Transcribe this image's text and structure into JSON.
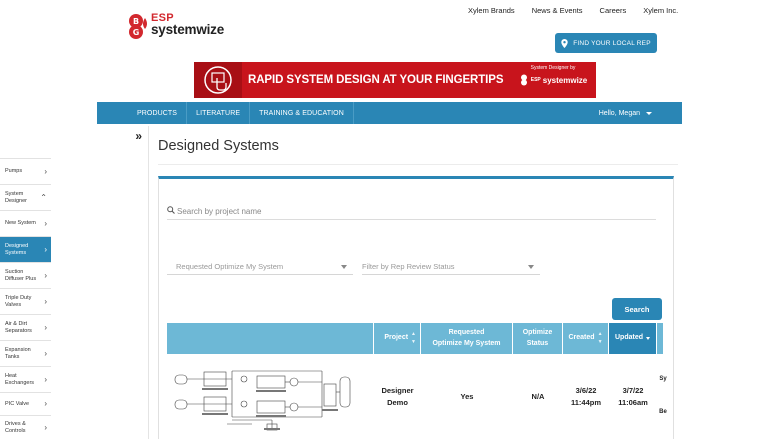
{
  "top_links": [
    "Xylem Brands",
    "News & Events",
    "Careers",
    "Xylem Inc."
  ],
  "logo": {
    "esp": "ESP",
    "systemwize": "systemwize"
  },
  "find_rep": "FIND YOUR LOCAL REP",
  "banner": {
    "headline": "RAPID SYSTEM DESIGN AT YOUR FINGERTIPS",
    "small": "System Designer by",
    "mini_esp": "ESP",
    "mini_sys": "systemwize"
  },
  "nav": {
    "items": [
      "PRODUCTS",
      "LITERATURE",
      "TRAINING & EDUCATION"
    ],
    "user": "Hello, Megan"
  },
  "sidebar": {
    "collapse": "»",
    "items": [
      {
        "label": "Pumps",
        "chevron": "›"
      },
      {
        "label": "System Designer",
        "chevron": "⌃"
      },
      {
        "label": "New System",
        "chevron": "›"
      },
      {
        "label": "Designed Systems",
        "chevron": "›"
      },
      {
        "label": "Suction Diffuser Plus",
        "chevron": "›"
      },
      {
        "label": "Triple Duty Valves",
        "chevron": "›"
      },
      {
        "label": "Air & Dirt Separators",
        "chevron": "›"
      },
      {
        "label": "Expansion Tanks",
        "chevron": "›"
      },
      {
        "label": "Heat Exchangers",
        "chevron": "›"
      },
      {
        "label": "PIC Valve",
        "chevron": "›"
      },
      {
        "label": "Drives & Controls",
        "chevron": "›"
      }
    ]
  },
  "page_title": "Designed Systems",
  "search": {
    "placeholder": "Search by project name"
  },
  "filters": {
    "optimize": "Requested Optimize My System",
    "rep_status": "Filter by Rep Review Status"
  },
  "search_button": "Search",
  "table": {
    "headers": {
      "project": "Project",
      "optimize_line1": "Requested",
      "optimize_line2": "Optimize My System",
      "status_line1": "Optimize",
      "status_line2": "Status",
      "created": "Created",
      "updated": "Updated"
    },
    "row": {
      "project_line1": "Designer",
      "project_line2": "Demo",
      "optimize": "Yes",
      "status": "N/A",
      "created_date": "3/6/22",
      "created_time": "11:44pm",
      "updated_date": "3/7/22",
      "updated_time": "11:06am",
      "extra_1": "Sy",
      "extra_2": "Be"
    }
  },
  "colors": {
    "brand_blue": "#2a86b5",
    "header_light": "#6db8d6",
    "banner_red": "#c8141c",
    "logo_red": "#d2282e"
  }
}
